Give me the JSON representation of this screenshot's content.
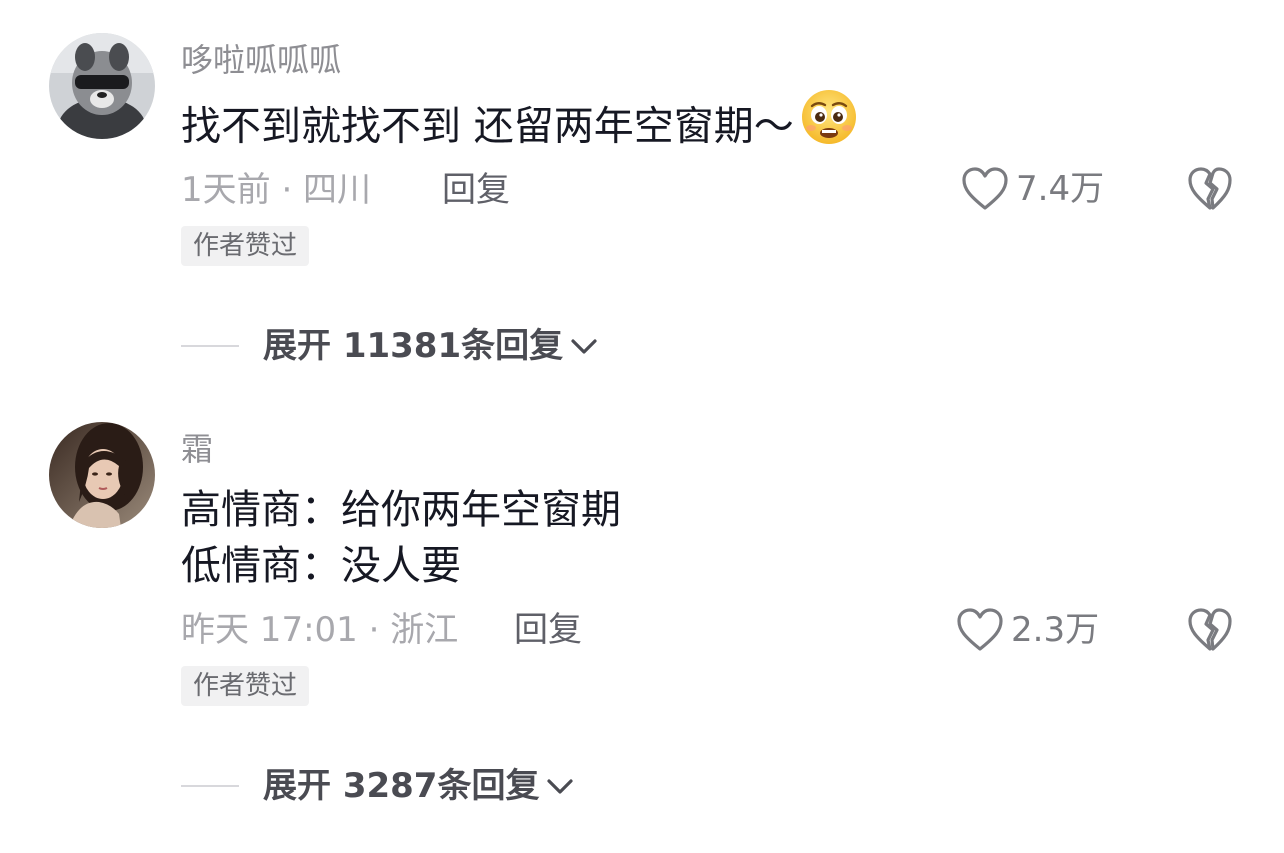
{
  "comments": [
    {
      "username": "哆啦呱呱呱",
      "text": "找不到就找不到 还留两年空窗期～",
      "emoji": "pleading-face-emoji",
      "meta": "1天前 · 四川",
      "reply_label": "回复",
      "likes": "7.4万",
      "author_badge": "作者赞过",
      "expand_label": "展开 11381条回复"
    },
    {
      "username": "霜",
      "text_lines": [
        "高情商：给你两年空窗期",
        "低情商：没人要"
      ],
      "meta": "昨天 17:01 · 浙江",
      "reply_label": "回复",
      "likes": "2.3万",
      "author_badge": "作者赞过",
      "expand_label": "展开 3287条回复"
    }
  ],
  "colors": {
    "text_primary": "#161823",
    "text_secondary": "#8e8e93",
    "badge_bg": "#f1f1f2",
    "divider": "#d8d8dc"
  },
  "icons": {
    "like": "heart-outline-icon",
    "dislike": "broken-heart-icon",
    "expand": "chevron-down-icon"
  }
}
